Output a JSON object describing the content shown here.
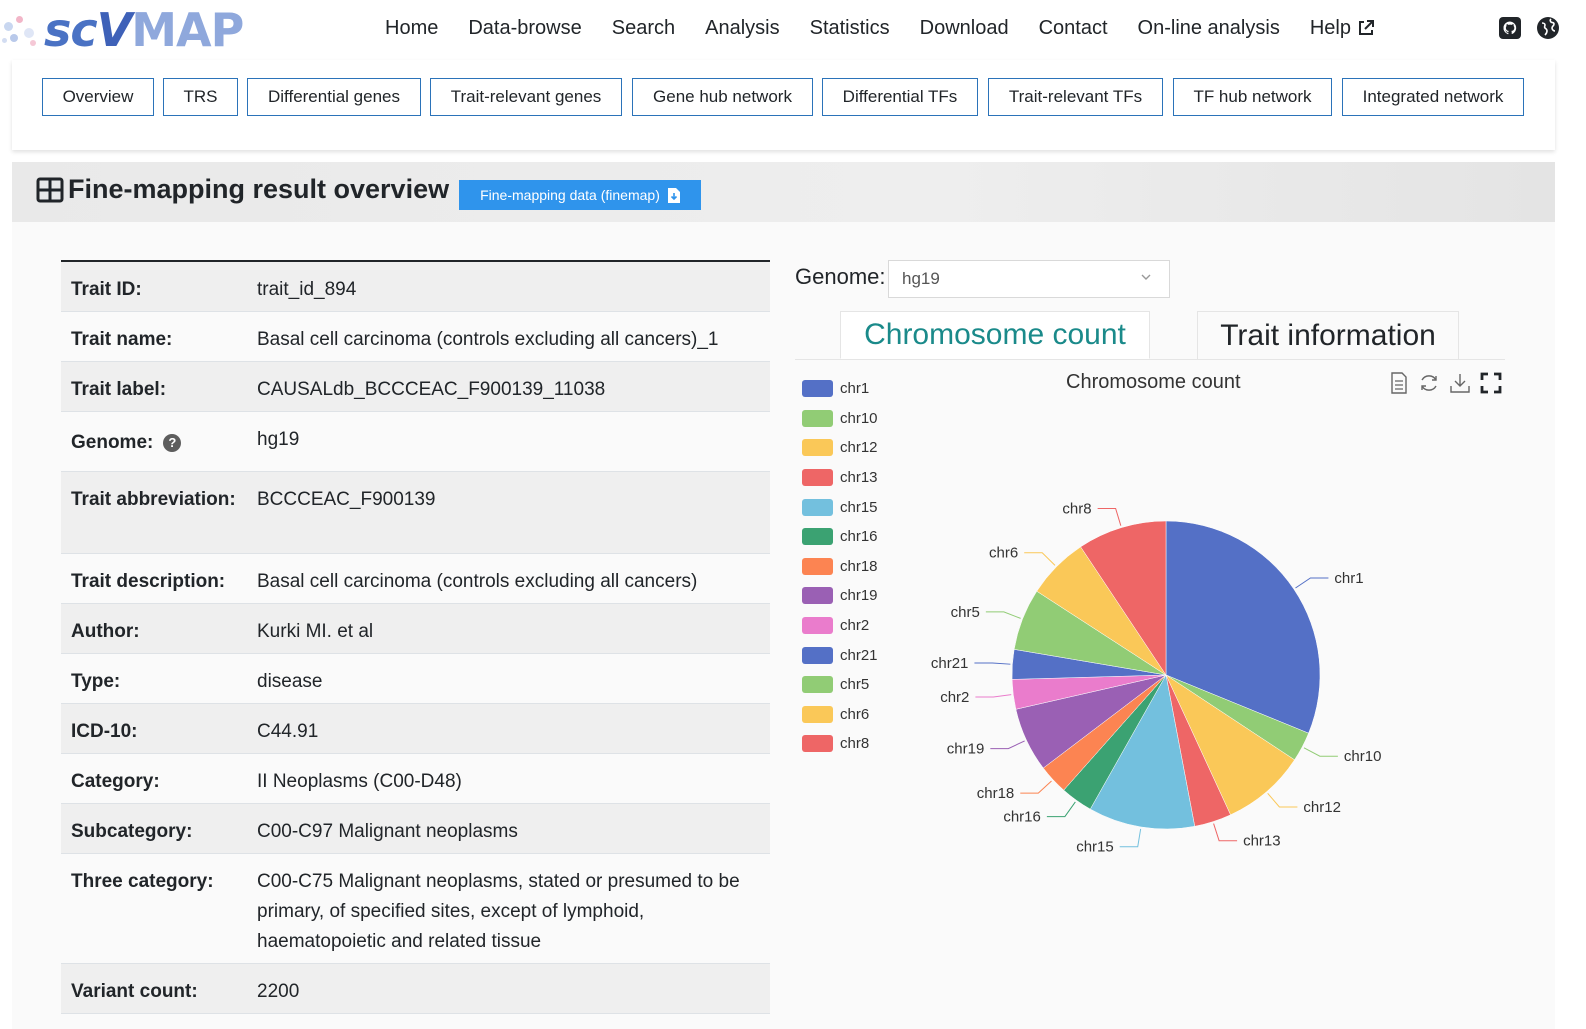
{
  "brand": {
    "prefix": "sc",
    "v": "V",
    "rest": "MAP"
  },
  "nav": {
    "items": [
      "Home",
      "Data-browse",
      "Search",
      "Analysis",
      "Statistics",
      "Download",
      "Contact",
      "On-line analysis",
      "Help"
    ],
    "icons": [
      "github-icon",
      "globe-icon"
    ]
  },
  "tabs": [
    "Overview",
    "TRS",
    "Differential genes",
    "Trait-relevant genes",
    "Gene hub network",
    "Differential TFs",
    "Trait-relevant TFs",
    "TF hub network",
    "Integrated network"
  ],
  "section": {
    "title": "Fine-mapping result overview",
    "download_label": "Fine-mapping data (finemap)"
  },
  "info": {
    "rows": [
      {
        "label": "Trait ID:",
        "value": "trait_id_894"
      },
      {
        "label": "Trait name:",
        "value": "Basal cell carcinoma (controls excluding all cancers)_1"
      },
      {
        "label": "Trait label:",
        "value": "CAUSALdb_BCCCEAC_F900139_11038"
      },
      {
        "label": "Genome:",
        "value": "hg19",
        "help": "?"
      },
      {
        "label": "Trait abbreviation:",
        "value": "BCCCEAC_F900139"
      },
      {
        "label": "Trait description:",
        "value": "Basal cell carcinoma (controls excluding all cancers)"
      },
      {
        "label": "Author:",
        "value": "Kurki MI. et al"
      },
      {
        "label": "Type:",
        "value": "disease"
      },
      {
        "label": "ICD-10:",
        "value": "C44.91"
      },
      {
        "label": "Category:",
        "value": "II Neoplasms (C00-D48)"
      },
      {
        "label": "Subcategory:",
        "value": "C00-C97 Malignant neoplasms"
      },
      {
        "label": "Three category:",
        "value": "C00-C75 Malignant neoplasms, stated or presumed to be primary, of specified sites, except of lymphoid, haematopoietic and related tissue"
      },
      {
        "label": "Variant count:",
        "value": "2200"
      }
    ]
  },
  "genome_select": {
    "label": "Genome:",
    "value": "hg19"
  },
  "right_tabs": {
    "active": "Chromosome count",
    "inactive": "Trait information"
  },
  "toolbox_icons": [
    "data-view-icon",
    "restore-icon",
    "save-image-icon",
    "fullscreen-icon"
  ],
  "chart_data": {
    "type": "pie",
    "title": "Chromosome count",
    "legend_position": "left",
    "categories": [
      "chr1",
      "chr10",
      "chr12",
      "chr13",
      "chr15",
      "chr16",
      "chr18",
      "chr19",
      "chr2",
      "chr21",
      "chr5",
      "chr6",
      "chr8"
    ],
    "values": [
      600,
      60,
      170,
      75,
      215,
      65,
      60,
      130,
      60,
      60,
      125,
      125,
      180
    ],
    "colors": [
      "#5470c6",
      "#91cc75",
      "#fac858",
      "#ee6666",
      "#73c0de",
      "#3ba272",
      "#fc8452",
      "#9a60b4",
      "#ea7ccc",
      "#5470c6",
      "#91cc75",
      "#fac858",
      "#ee6666"
    ]
  }
}
